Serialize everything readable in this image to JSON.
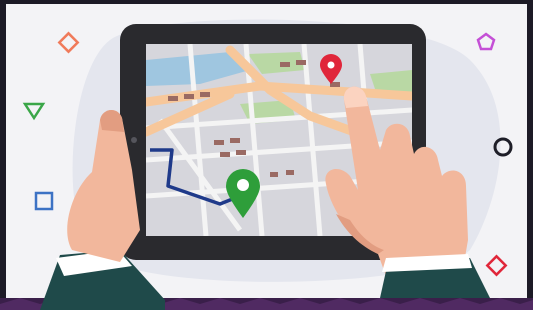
{
  "scene": {
    "subject": "hands-holding-tablet-with-map",
    "colors": {
      "frame": "#1c1a26",
      "screen_bg": "#f3f3f6",
      "bottom_strip": "#3a1f4a",
      "tablet_body": "#2a2a2e",
      "map_bg": "#d6d6dc",
      "road": "#f4f4f4",
      "main_road": "#f7c79a",
      "park": "#b9d8a4",
      "water": "#9fc6e0",
      "building": "#9a6a63",
      "route": "#1f3a8a",
      "pin_red": "#e0263a",
      "pin_green": "#2e9e3a",
      "skin": "#f2b79c",
      "skin_shadow": "#e29d81",
      "sleeve": "#1f4a4a",
      "cuff": "#ffffff"
    },
    "floating_shapes": [
      {
        "icon": "diamond-outline",
        "color": "#f07a5a"
      },
      {
        "icon": "pentagon-outline",
        "color": "#c44fd6"
      },
      {
        "icon": "triangle-outline",
        "color": "#3aa648"
      },
      {
        "icon": "circle-outline",
        "color": "#1e1e28"
      },
      {
        "icon": "square-outline",
        "color": "#3c72c4"
      },
      {
        "icon": "diamond-outline",
        "color": "#e0263a"
      }
    ]
  }
}
